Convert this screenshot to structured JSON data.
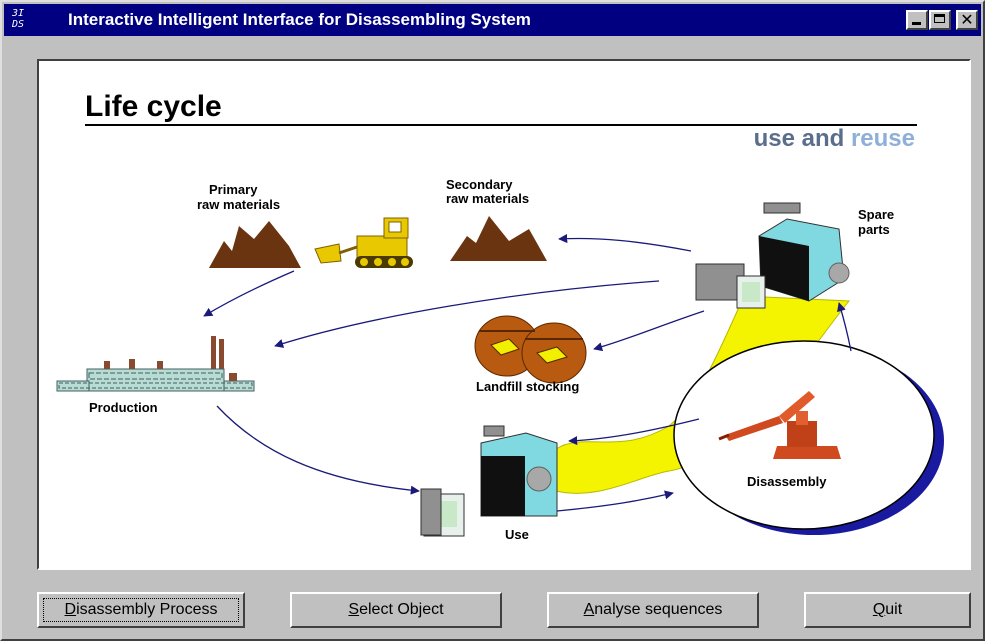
{
  "window": {
    "title": "Interactive Intelligent Interface for Disassembling System",
    "icon_text_top": "3I",
    "icon_text_bottom": "DS",
    "controls": [
      "minimize-icon",
      "maximize-icon",
      "close-icon"
    ],
    "close_glyph": "✕"
  },
  "diagram": {
    "heading": "Life cycle",
    "subtitle_part1": "use and ",
    "subtitle_part2": "reuse",
    "labels": {
      "primary_line1": "Primary",
      "primary_line2": "raw materials",
      "secondary_line1": "Secondary",
      "secondary_line2": "raw materials",
      "spare_line1": "Spare",
      "spare_line2": "parts",
      "landfill": "Landfill stocking",
      "production": "Production",
      "disassembly": "Disassembly",
      "use": "Use"
    },
    "colors": {
      "heading": "#000000",
      "subtitle": "#5a6e8c",
      "reuse": "#8eb0d8",
      "mountain": "#6b3410",
      "bulldozer": "#e8c800",
      "barrel": "#b85a10",
      "flow_band": "#f4f400",
      "circle_shadow": "#1a1aa0",
      "robot": "#d04a20",
      "arrows": "#1a1a7a"
    }
  },
  "buttons": {
    "disassembly_process": {
      "mnemonic": "D",
      "rest": "isassembly Process"
    },
    "select_object": {
      "mnemonic": "S",
      "rest": "elect Object"
    },
    "analyse_sequences": {
      "mnemonic": "A",
      "rest": "nalyse sequences"
    },
    "quit": {
      "mnemonic": "Q",
      "rest": "uit"
    }
  }
}
